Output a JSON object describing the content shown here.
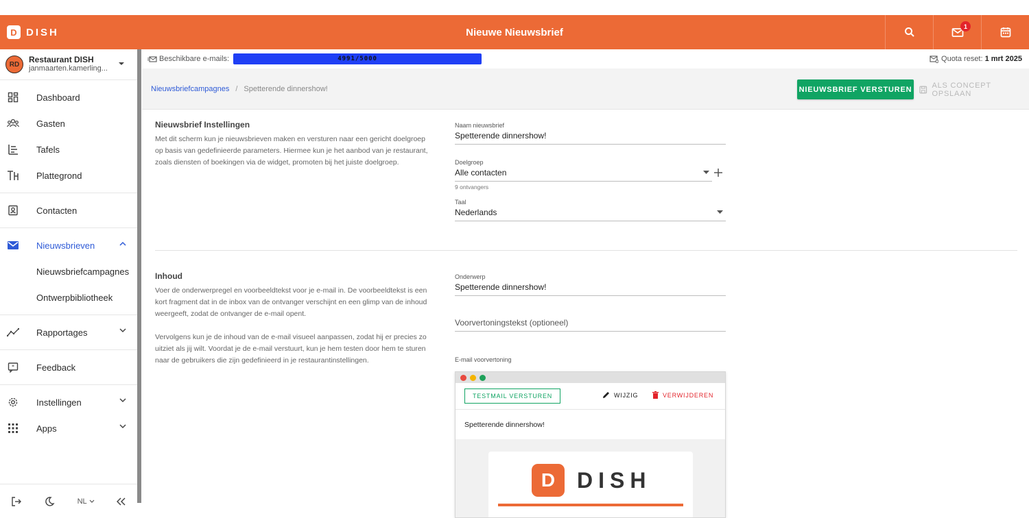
{
  "topbar": {
    "brand": "DISH",
    "brand_mark": "D",
    "title": "Nieuwe Nieuwsbrief",
    "notification_count": "1",
    "icons": [
      "search-icon",
      "mail-icon",
      "calendar-icon"
    ]
  },
  "account": {
    "initials": "RD",
    "name": "Restaurant DISH",
    "email": "janmaarten.kamerling..."
  },
  "sidebar": {
    "groups": [
      {
        "items": [
          {
            "label": "Dashboard",
            "icon": "dashboard-icon"
          },
          {
            "label": "Gasten",
            "icon": "guests-icon"
          },
          {
            "label": "Tafels",
            "icon": "tables-icon"
          },
          {
            "label": "Plattegrond",
            "icon": "floorplan-icon"
          }
        ]
      },
      {
        "items": [
          {
            "label": "Contacten",
            "icon": "contacts-icon"
          }
        ]
      },
      {
        "items": [
          {
            "label": "Nieuwsbrieven",
            "icon": "envelope-icon",
            "active": true
          }
        ],
        "sub": [
          "Nieuwsbriefcampagnes",
          "Ontwerpbibliotheek"
        ]
      },
      {
        "items": [
          {
            "label": "Rapportages",
            "icon": "chart-icon"
          }
        ]
      },
      {
        "items": [
          {
            "label": "Feedback",
            "icon": "feedback-icon"
          }
        ]
      },
      {
        "items": [
          {
            "label": "Instellingen",
            "icon": "settings-icon"
          },
          {
            "label": "Apps",
            "icon": "apps-icon"
          }
        ]
      }
    ],
    "footer": {
      "language": "NL"
    }
  },
  "quota": {
    "label": "Beschikbare e-mails:",
    "value_text": "4991/5000",
    "used": 4991,
    "total": 5000,
    "reset_label": "Quota reset:",
    "reset_date": "1 mrt 2025"
  },
  "breadcrumb": {
    "parent": "Nieuwsbriefcampagnes",
    "separator": "/",
    "current": "Spetterende dinnershow!"
  },
  "actions": {
    "send": "NIEUWSBRIEF VERSTUREN",
    "save_concept": "ALS CONCEPT OPSLAAN"
  },
  "settings": {
    "title": "Nieuwsbrief Instellingen",
    "description": "Met dit scherm kun je nieuwsbrieven maken en versturen naar een gericht doelgroep op basis van gedefinieerde parameters. Hiermee kun je het aanbod van je restaurant, zoals diensten of boekingen via de widget, promoten bij het juiste doelgroep.",
    "name_label": "Naam nieuwsbrief",
    "name_value": "Spetterende dinnershow!",
    "audience_label": "Doelgroep",
    "audience_value": "Alle contacten",
    "audience_hint": "9 ontvangers",
    "language_label": "Taal",
    "language_value": "Nederlands"
  },
  "content": {
    "title": "Inhoud",
    "description_1": "Voer de onderwerpregel en voorbeeldtekst voor je e-mail in. De voorbeeldtekst is een kort fragment dat in de inbox van de ontvanger verschijnt en een glimp van de inhoud weergeeft, zodat de ontvanger de e-mail opent.",
    "description_2": "Vervolgens kun je de inhoud van de e-mail visueel aanpassen, zodat hij er precies zo uitziet als jij wilt. Voordat je de e-mail verstuurt, kun je hem testen door hem te sturen naar de gebruikers die zijn gedefinieerd in je restaurantinstellingen.",
    "subject_label": "Onderwerp",
    "subject_value": "Spetterende dinnershow!",
    "preview_text_placeholder": "Voorvertoningstekst (optioneel)",
    "preview_label": "E-mail voorvertoning"
  },
  "preview": {
    "test_button": "TESTMAIL VERSTUREN",
    "edit": "WIJZIG",
    "delete": "VERWIJDEREN",
    "subject": "Spetterende dinnershow!",
    "logo_mark": "D",
    "logo_word": "DISH"
  },
  "colors": {
    "brand": "#ec6a36",
    "accent_blue": "#2f5bd7",
    "success": "#10a463",
    "danger": "#e3242b"
  }
}
